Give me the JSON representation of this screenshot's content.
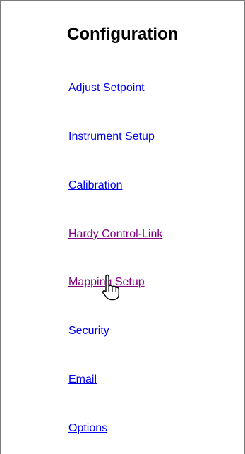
{
  "page": {
    "title": "Configuration"
  },
  "nav": {
    "items": [
      {
        "label": "Adjust Setpoint",
        "state": "unvisited"
      },
      {
        "label": "Instrument Setup",
        "state": "unvisited"
      },
      {
        "label": "Calibration",
        "state": "unvisited"
      },
      {
        "label": "Hardy Control-Link",
        "state": "visited"
      },
      {
        "label": "Mapping Setup",
        "state": "visited"
      },
      {
        "label": "Security",
        "state": "unvisited"
      },
      {
        "label": "Email",
        "state": "unvisited"
      },
      {
        "label": "Options",
        "state": "unvisited"
      }
    ]
  },
  "colors": {
    "link": "#0000ee",
    "visited_link": "#800080",
    "border": "#7a7a7a"
  },
  "cursor": {
    "icon": "hand-pointer-icon"
  }
}
